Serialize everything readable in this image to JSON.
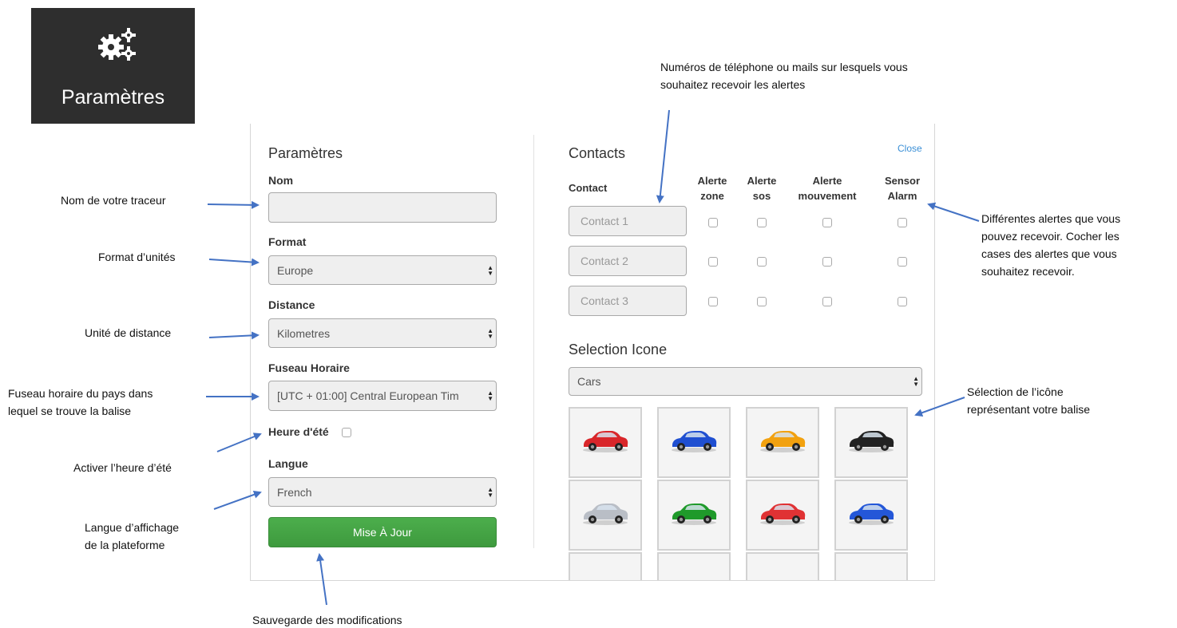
{
  "badge": {
    "label": "Paramètres",
    "icon": "gears-icon"
  },
  "settings": {
    "title": "Paramètres",
    "nom_label": "Nom",
    "nom_value": "",
    "format_label": "Format",
    "format_value": "Europe",
    "distance_label": "Distance",
    "distance_value": "Kilometres",
    "fuseau_label": "Fuseau Horaire",
    "fuseau_value": "[UTC + 01:00] Central European Tim",
    "heure_ete_label": "Heure d'été",
    "heure_ete_checked": false,
    "langue_label": "Langue",
    "langue_value": "French",
    "update_button": "Mise À Jour"
  },
  "contacts": {
    "title": "Contacts",
    "close_label": "Close",
    "contact_header": "Contact",
    "columns": [
      {
        "line1": "Alerte",
        "line2": "zone"
      },
      {
        "line1": "Alerte",
        "line2": "sos"
      },
      {
        "line1": "Alerte",
        "line2": "mouvement"
      },
      {
        "line1": "Sensor",
        "line2": "Alarm"
      }
    ],
    "rows": [
      {
        "placeholder": "Contact 1"
      },
      {
        "placeholder": "Contact 2"
      },
      {
        "placeholder": "Contact 3"
      }
    ]
  },
  "icon_selection": {
    "title": "Selection Icone",
    "category_value": "Cars",
    "car_colors": [
      "#d9262a",
      "#1f4fd1",
      "#f2a10f",
      "#222222",
      "#b9bec6",
      "#1f9a2a",
      "#e03234",
      "#2457d8"
    ]
  },
  "annotations": {
    "nom": "Nom de votre traceur",
    "format": "Format d’unités",
    "distance": "Unité de distance",
    "fuseau_line1": "Fuseau horaire du pays dans",
    "fuseau_line2": "lequel se trouve la balise",
    "heure_ete": "Activer l’heure d’été",
    "langue_line1": "Langue d’affichage",
    "langue_line2": "de la plateforme",
    "save": "Sauvegarde des modifications",
    "contacts_line1": "Numéros de téléphone ou mails sur lesquels vous",
    "contacts_line2": "souhaitez recevoir les alertes",
    "alerts_line1": "Différentes alertes que vous",
    "alerts_line2": "pouvez recevoir. Cocher les",
    "alerts_line3": "cases des alertes que vous",
    "alerts_line4": "souhaitez recevoir.",
    "icon_line1": "Sélection de l’icône",
    "icon_line2": "représentant votre balise"
  },
  "colors": {
    "accent_green": "#45a845",
    "arrow_blue": "#4472c4",
    "link_blue": "#3a8fd6"
  }
}
